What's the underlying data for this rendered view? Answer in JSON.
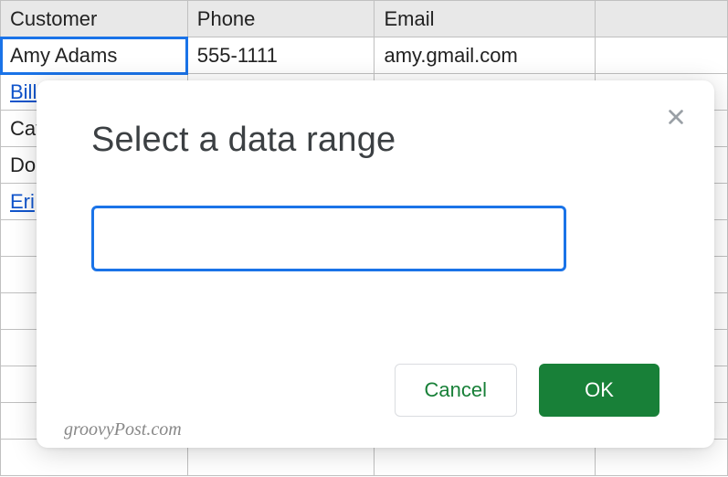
{
  "spreadsheet": {
    "headers": [
      "Customer",
      "Phone",
      "Email"
    ],
    "rows": [
      {
        "customer": "Amy Adams",
        "phone": "555-1111",
        "email": "amy.gmail.com",
        "is_link": false
      },
      {
        "customer": "Bill",
        "phone": "",
        "email": "",
        "is_link": true
      },
      {
        "customer": "Cat",
        "phone": "",
        "email": "",
        "is_link": false
      },
      {
        "customer": "Do",
        "phone": "",
        "email": "",
        "is_link": false
      },
      {
        "customer": "Eri",
        "phone": "",
        "email": "",
        "is_link": true
      }
    ],
    "selected_cell": {
      "row": 0,
      "col": 0
    }
  },
  "dialog": {
    "title": "Select a data range",
    "input_value": "",
    "cancel_label": "Cancel",
    "ok_label": "OK"
  },
  "watermark": "groovyPost.com"
}
